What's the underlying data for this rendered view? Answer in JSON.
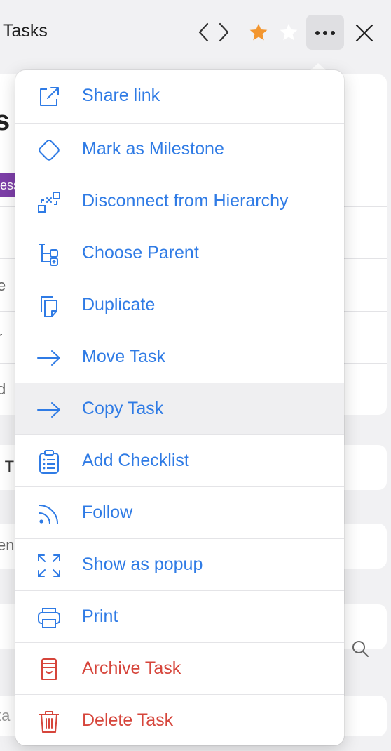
{
  "header": {
    "title": "Tasks",
    "favorite_icon": "star-filled-icon",
    "colors": {
      "star": "#f3962f",
      "accent": "#2f7be5",
      "danger": "#d6453b"
    }
  },
  "background": {
    "fragments": [
      "s",
      "ess",
      "e",
      "r",
      "d",
      "l T",
      "en",
      "ta"
    ]
  },
  "menu": {
    "items": [
      {
        "label": "Share link",
        "icon": "external-link-icon",
        "kind": "normal"
      },
      {
        "label": "Mark as Milestone",
        "icon": "diamond-icon",
        "kind": "normal"
      },
      {
        "label": "Disconnect from Hierarchy",
        "icon": "disconnect-icon",
        "kind": "normal"
      },
      {
        "label": "Choose Parent",
        "icon": "hierarchy-icon",
        "kind": "normal"
      },
      {
        "label": "Duplicate",
        "icon": "duplicate-icon",
        "kind": "normal"
      },
      {
        "label": "Move Task",
        "icon": "arrow-right-icon",
        "kind": "normal"
      },
      {
        "label": "Copy Task",
        "icon": "arrow-right-icon",
        "kind": "hover"
      },
      {
        "label": "Add Checklist",
        "icon": "checklist-icon",
        "kind": "normal"
      },
      {
        "label": "Follow",
        "icon": "rss-icon",
        "kind": "normal"
      },
      {
        "label": "Show as popup",
        "icon": "expand-icon",
        "kind": "normal"
      },
      {
        "label": "Print",
        "icon": "printer-icon",
        "kind": "normal"
      },
      {
        "label": "Archive Task",
        "icon": "archive-icon",
        "kind": "danger"
      },
      {
        "label": "Delete Task",
        "icon": "trash-icon",
        "kind": "danger"
      }
    ]
  }
}
